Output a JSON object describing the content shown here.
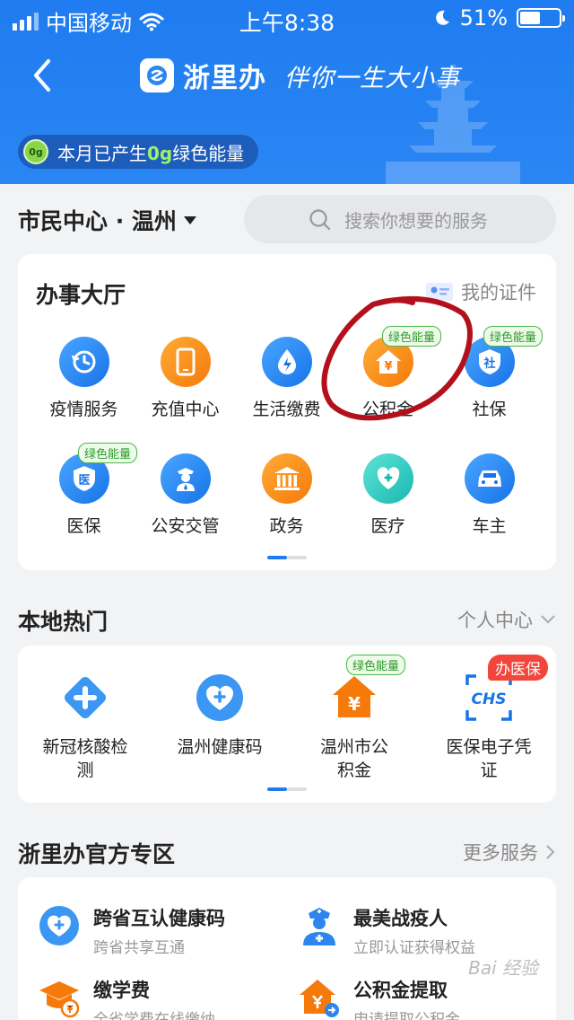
{
  "status_bar": {
    "carrier": "中国移动",
    "time": "上午8:38",
    "battery": "51%"
  },
  "header": {
    "app_name": "浙里办",
    "slogan": "伴你一生大小事",
    "energy_prefix": "本月已产生",
    "energy_value": "0g",
    "energy_suffix": "绿色能量",
    "energy_badge": "0g"
  },
  "location": {
    "city": "市民中心 · 温州"
  },
  "search": {
    "placeholder": "搜索你想要的服务"
  },
  "hall": {
    "title": "办事大厅",
    "link": "我的证件",
    "items": [
      {
        "label": "疫情服务",
        "icon": "clock-history-icon"
      },
      {
        "label": "充值中心",
        "icon": "phone-icon"
      },
      {
        "label": "生活缴费",
        "icon": "water-bolt-icon"
      },
      {
        "label": "公积金",
        "icon": "house-yuan-icon",
        "tag": "绿色能量"
      },
      {
        "label": "社保",
        "icon": "shield-she-icon",
        "tag": "绿色能量",
        "glyph": "社"
      },
      {
        "label": "医保",
        "icon": "shield-yi-icon",
        "tag": "绿色能量",
        "glyph": "医"
      },
      {
        "label": "公安交管",
        "icon": "police-icon"
      },
      {
        "label": "政务",
        "icon": "government-building-icon"
      },
      {
        "label": "医疗",
        "icon": "stethoscope-icon"
      },
      {
        "label": "车主",
        "icon": "car-icon"
      }
    ],
    "house_glyph": "¥"
  },
  "hot": {
    "title": "本地热门",
    "link": "个人中心",
    "items": [
      {
        "label": "新冠核酸检测",
        "icon": "medical-cross-icon"
      },
      {
        "label": "温州健康码",
        "icon": "heart-plus-icon"
      },
      {
        "label": "温州市公积金",
        "icon": "house-yuan-icon",
        "tag": "绿色能量"
      },
      {
        "label": "医保电子凭证",
        "icon": "chs-scan-icon",
        "tag": "办医保"
      }
    ],
    "chs_text": "CHS",
    "house_glyph": "¥"
  },
  "official": {
    "title": "浙里办官方专区",
    "link": "更多服务",
    "items": [
      {
        "title": "跨省互认健康码",
        "subtitle": "跨省共享互通",
        "icon": "heart-plus-icon"
      },
      {
        "title": "最美战疫人",
        "subtitle": "立即认证获得权益",
        "icon": "nurse-icon"
      },
      {
        "title": "缴学费",
        "subtitle": "全省学费在线缴纳",
        "icon": "graduation-cap-icon"
      },
      {
        "title": "公积金提取",
        "subtitle": "申请提取公积金",
        "icon": "house-withdraw-icon"
      }
    ]
  },
  "watermark": "Bai 经验",
  "colors": {
    "header_blue": "#1f7cf0",
    "icon_blue": "#1773e8",
    "icon_orange": "#f57a0a",
    "icon_teal": "#18b8b0",
    "green_tag": "#2b9a2b",
    "red_tag": "#f2463c",
    "annotation_red": "#b3101c"
  }
}
